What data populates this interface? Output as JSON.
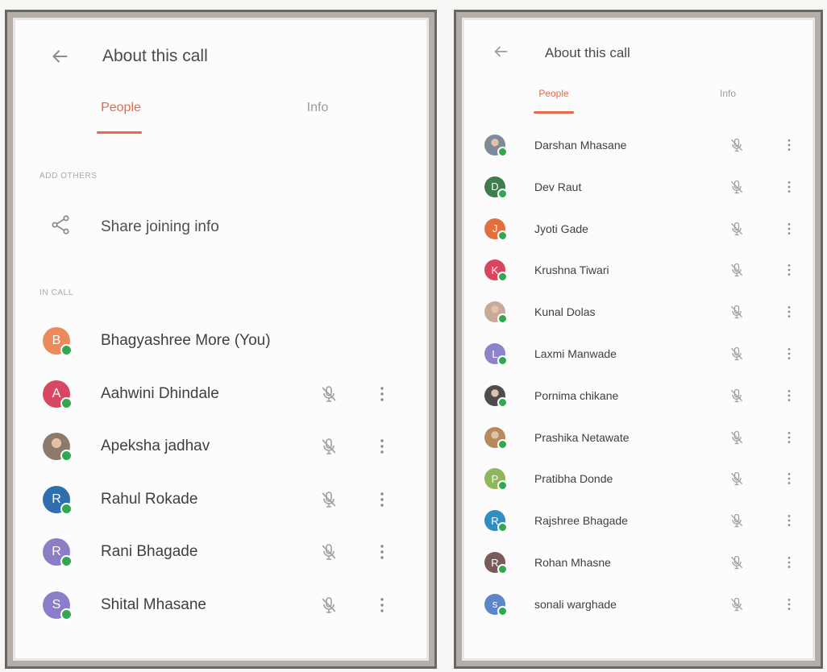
{
  "left_panel": {
    "header": {
      "title": "About this call",
      "back_icon": "back-arrow-icon"
    },
    "tabs": [
      {
        "label": "People",
        "active": true
      },
      {
        "label": "Info",
        "active": false
      }
    ],
    "add_others": {
      "label": "ADD OTHERS",
      "share": {
        "label": "Share joining info",
        "icon": "share-icon"
      }
    },
    "in_call_label": "IN CALL",
    "participants": [
      {
        "name": "Bhagyashree More (You)",
        "initial": "B",
        "color": "#ec8a5c",
        "photo": false,
        "mute_controls": false
      },
      {
        "name": "Aahwini Dhindale",
        "initial": "A",
        "color": "#d84860",
        "photo": false,
        "mute_controls": true
      },
      {
        "name": "Apeksha jadhav",
        "initial": "",
        "color": "#8c7a6c",
        "photo": true,
        "mute_controls": true
      },
      {
        "name": "Rahul Rokade",
        "initial": "R",
        "color": "#2f6fad",
        "photo": false,
        "mute_controls": true
      },
      {
        "name": "Rani Bhagade",
        "initial": "R",
        "color": "#8c7dc6",
        "photo": false,
        "mute_controls": true
      },
      {
        "name": "Shital Mhasane",
        "initial": "S",
        "color": "#8a7dca",
        "photo": false,
        "mute_controls": true
      }
    ]
  },
  "right_panel": {
    "header": {
      "title": "About this call",
      "back_icon": "back-arrow-icon"
    },
    "tabs": [
      {
        "label": "People",
        "active": true
      },
      {
        "label": "Info",
        "active": false
      }
    ],
    "participants": [
      {
        "name": "Darshan Mhasane",
        "initial": "",
        "color": "#7d8a9a",
        "photo": true
      },
      {
        "name": "Dev Raut",
        "initial": "D",
        "color": "#3f7d4c",
        "photo": false
      },
      {
        "name": "Jyoti Gade",
        "initial": "J",
        "color": "#e2703f",
        "photo": false
      },
      {
        "name": "Krushna Tiwari",
        "initial": "K",
        "color": "#d8465e",
        "photo": false
      },
      {
        "name": "Kunal Dolas",
        "initial": "",
        "color": "#c9a99a",
        "photo": true
      },
      {
        "name": "Laxmi Manwade",
        "initial": "L",
        "color": "#8a84cc",
        "photo": false
      },
      {
        "name": "Pornima chikane",
        "initial": "",
        "color": "#4d4d4d",
        "photo": true
      },
      {
        "name": "Prashika Netawate",
        "initial": "",
        "color": "#b58a5c",
        "photo": true
      },
      {
        "name": "Pratibha Donde",
        "initial": "P",
        "color": "#8fb65a",
        "photo": false
      },
      {
        "name": "Rajshree Bhagade",
        "initial": "R",
        "color": "#2f8ec4",
        "photo": false
      },
      {
        "name": "Rohan Mhasne",
        "initial": "R",
        "color": "#7a5a5a",
        "photo": false
      },
      {
        "name": "sonali warghade",
        "initial": "s",
        "color": "#5c86c8",
        "photo": false
      }
    ]
  },
  "icons": {
    "mic_off": "mic-off-icon",
    "more": "more-vert-icon",
    "online": "online-status-dot"
  },
  "colors": {
    "accent": "#e46b4e",
    "online": "#2fa84f",
    "text": "#3c4043",
    "muted": "#a8a8a8"
  }
}
